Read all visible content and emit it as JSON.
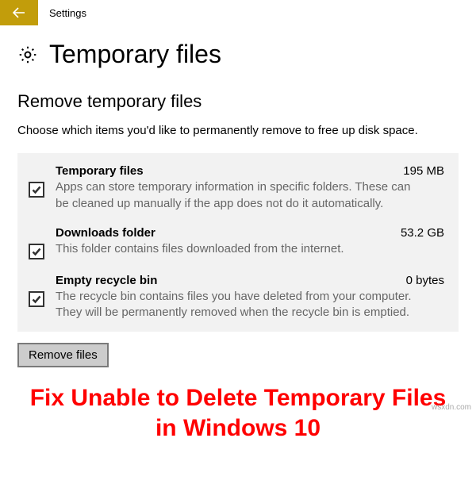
{
  "titlebar": {
    "app_name": "Settings"
  },
  "page": {
    "title": "Temporary files",
    "section_heading": "Remove temporary files",
    "intro": "Choose which items you'd like to permanently remove to free up disk space."
  },
  "items": [
    {
      "title": "Temporary files",
      "size": "195 MB",
      "desc": "Apps can store temporary information in specific folders. These can be cleaned up manually if the app does not do it automatically.",
      "checked": true
    },
    {
      "title": "Downloads folder",
      "size": "53.2 GB",
      "desc": "This folder contains files downloaded from the internet.",
      "checked": true
    },
    {
      "title": "Empty recycle bin",
      "size": "0 bytes",
      "desc": "The recycle bin contains files you have deleted from your computer. They will be permanently removed when the recycle bin is emptied.",
      "checked": true
    }
  ],
  "actions": {
    "remove_label": "Remove files"
  },
  "article": {
    "headline": "Fix Unable to Delete Temporary Files in Windows 10"
  },
  "watermark": "wsxdn.com"
}
